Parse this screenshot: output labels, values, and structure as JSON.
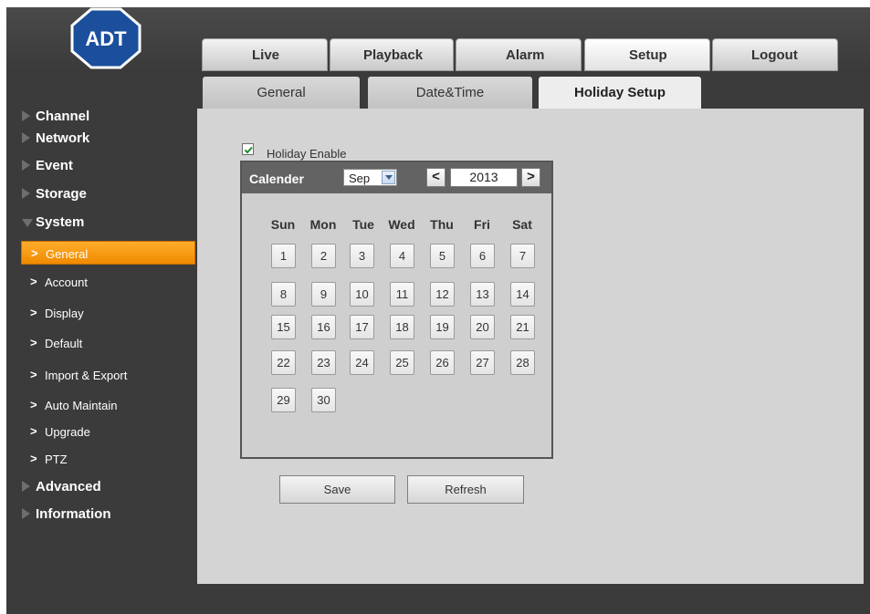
{
  "logo_text": "ADT",
  "main_tabs": [
    {
      "label": "Live"
    },
    {
      "label": "Playback"
    },
    {
      "label": "Alarm"
    },
    {
      "label": "Setup"
    },
    {
      "label": "Logout"
    }
  ],
  "sidebar": {
    "top": [
      "Channel",
      "Network",
      "Event",
      "Storage",
      "System",
      "Advanced",
      "Information"
    ],
    "system_items": [
      "General",
      "Account",
      "Display",
      "Default",
      "Import & Export",
      "Auto Maintain",
      "Upgrade",
      "PTZ"
    ]
  },
  "sub_tabs": [
    {
      "label": "General"
    },
    {
      "label": "Date&Time"
    },
    {
      "label": "Holiday Setup"
    }
  ],
  "holiday": {
    "enable_label": "Holiday Enable",
    "enabled": true,
    "calendar_title": "Calender",
    "month": "Sep",
    "year": "2013",
    "prev": "<",
    "next": ">",
    "weekdays": [
      "Sun",
      "Mon",
      "Tue",
      "Wed",
      "Thu",
      "Fri",
      "Sat"
    ],
    "days": [
      "1",
      "2",
      "3",
      "4",
      "5",
      "6",
      "7",
      "8",
      "9",
      "10",
      "11",
      "12",
      "13",
      "14",
      "15",
      "16",
      "17",
      "18",
      "19",
      "20",
      "21",
      "22",
      "23",
      "24",
      "25",
      "26",
      "27",
      "28",
      "29",
      "30"
    ]
  },
  "buttons": {
    "save": "Save",
    "refresh": "Refresh"
  },
  "colors": {
    "accent": "#f39200",
    "panel": "#d4d4d4",
    "background": "#3b3b3b"
  }
}
